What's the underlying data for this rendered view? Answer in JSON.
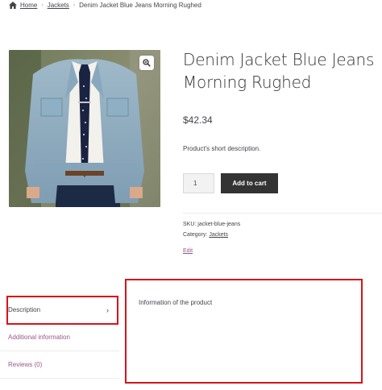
{
  "breadcrumb": {
    "home": "Home",
    "category": "Jackets",
    "current": "Denim Jacket Blue Jeans Morning Rughed",
    "separator": "›"
  },
  "product": {
    "image_alt": "Denim jacket worn over a white shirt with a navy dotted tie",
    "zoom_icon": "magnifier-zoom-icon",
    "title": "Denim Jacket Blue Jeans Morning Rughed",
    "price": "$42.34",
    "short_description": "Product's short description.",
    "quantity": "1",
    "add_to_cart_label": "Add to cart"
  },
  "meta": {
    "sku_label": "SKU:",
    "sku_value": "jacket-blue-jeans",
    "category_label": "Category:",
    "category_value": "Jackets",
    "edit_label": "Edit"
  },
  "tabs": [
    {
      "label": "Description",
      "active": true
    },
    {
      "label": "Additional information",
      "active": false
    },
    {
      "label": "Reviews (0)",
      "active": false
    }
  ],
  "panel": {
    "text": "Information of the product"
  },
  "colors": {
    "accent_link": "#96588a",
    "button_bg": "#333333",
    "highlight_border": "#d7141a"
  }
}
